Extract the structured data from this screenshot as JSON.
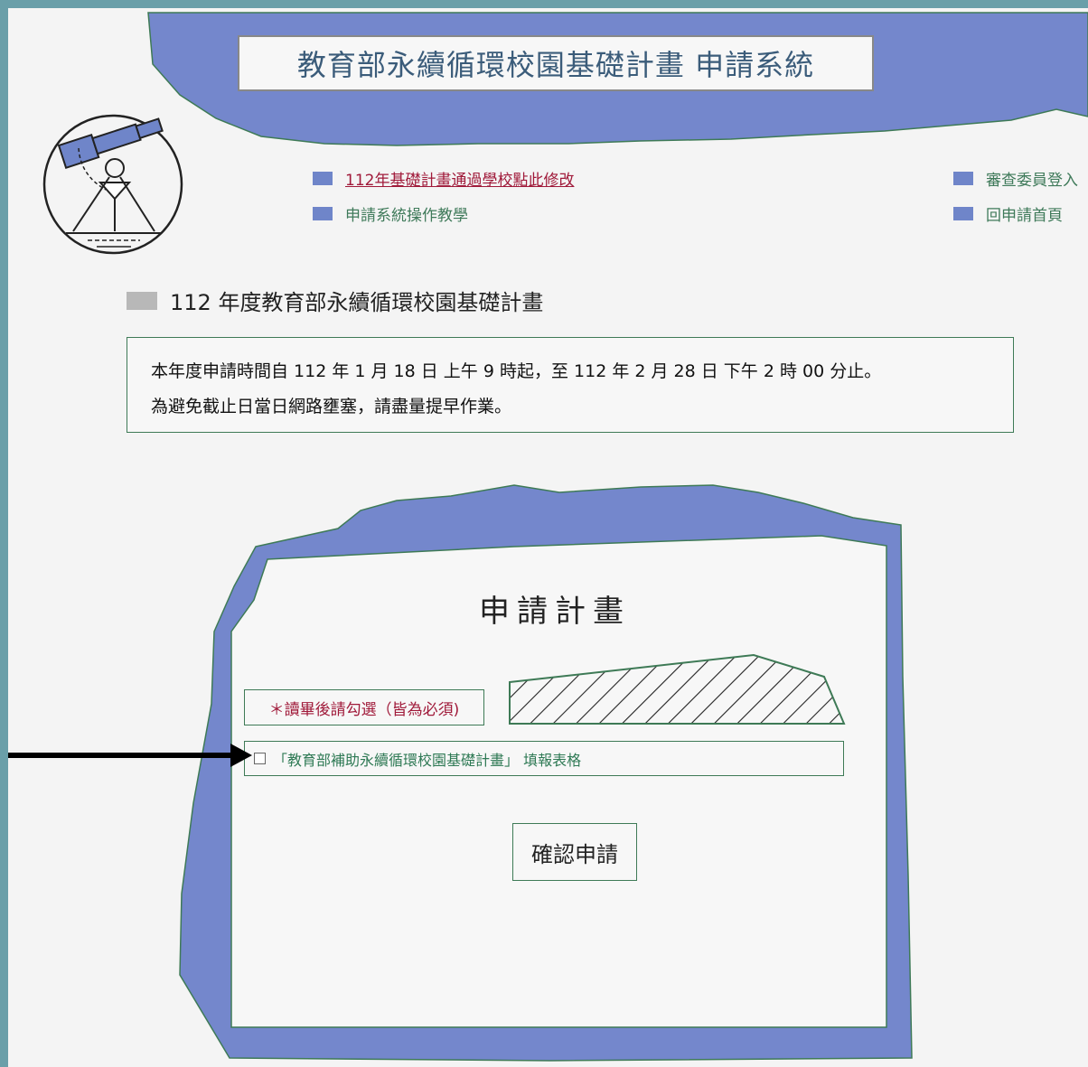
{
  "header": {
    "title": "教育部永續循環校園基礎計畫 申請系統"
  },
  "nav": {
    "left": [
      {
        "label": "112年基礎計畫通過學校點此修改",
        "is_link": true
      },
      {
        "label": "申請系統操作教學",
        "is_link": false
      }
    ],
    "right": [
      {
        "label": "審查委員登入"
      },
      {
        "label": "回申請首頁"
      }
    ]
  },
  "section": {
    "heading": "112 年度教育部永續循環校園基礎計畫",
    "notice_line1": "本年度申請時間自 112 年 1 月 18 日 上午 9 時起，至 112 年 2 月 28 日 下午 2 時 00 分止。",
    "notice_line2": "為避免截止日當日網路壅塞，請盡量提早作業。"
  },
  "form": {
    "title": "申請計畫",
    "required_note": "＊讀畢後請勾選（皆為必須)",
    "checkbox_label": "「教育部補助永續循環校園基礎計畫」 填報表格",
    "checkbox_checked": false,
    "confirm_label": "確認申請"
  },
  "colors": {
    "frame": "#6a9fa9",
    "blue_shape": "#7487cc",
    "border_green": "#3e7a56",
    "link_red": "#a01a3a"
  }
}
